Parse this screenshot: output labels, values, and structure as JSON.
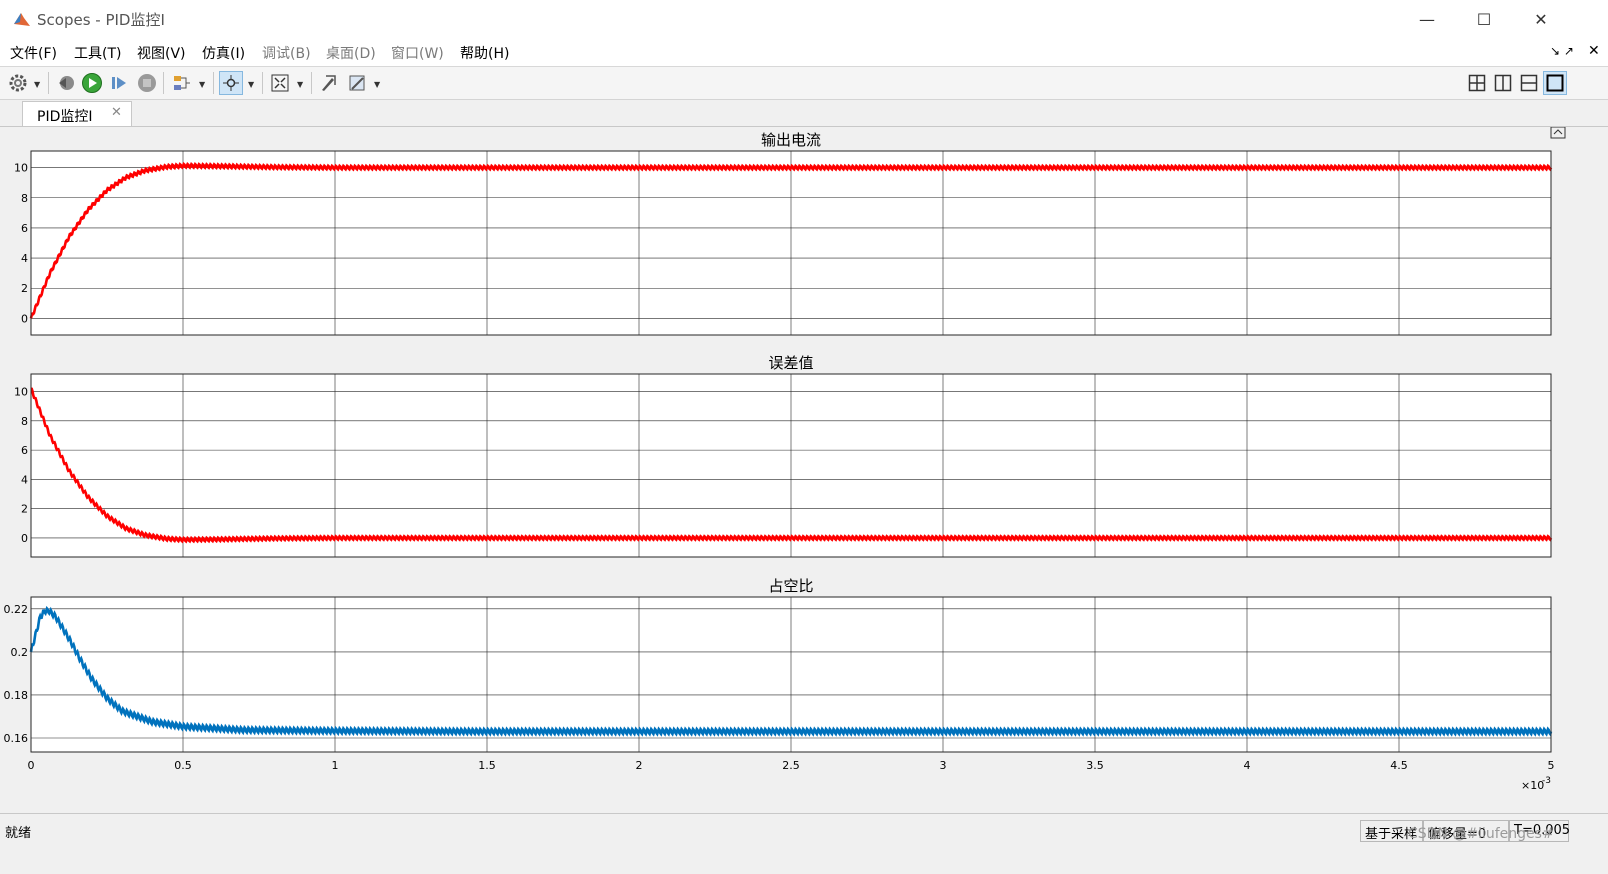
{
  "window": {
    "title": "Scopes - PID监控I",
    "minimize_glyph": "—",
    "maximize_glyph": "☐",
    "close_glyph": "✕"
  },
  "menu": {
    "items": [
      {
        "label": "文件(F)",
        "enabled": true
      },
      {
        "label": "工具(T)",
        "enabled": true
      },
      {
        "label": "视图(V)",
        "enabled": true
      },
      {
        "label": "仿真(I)",
        "enabled": true
      },
      {
        "label": "调试(B)",
        "enabled": false
      },
      {
        "label": "桌面(D)",
        "enabled": false
      },
      {
        "label": "窗口(W)",
        "enabled": false
      },
      {
        "label": "帮助(H)",
        "enabled": true
      }
    ],
    "undock_glyph": "↘ ↗",
    "close_glyph": "✕"
  },
  "toolbar": {
    "icons": [
      "gear-icon",
      "step-back-icon",
      "run-icon",
      "step-forward-icon",
      "stop-icon",
      "highlight-icon",
      "zoom-icon",
      "autoscale-icon",
      "style-icon",
      "measure-icon"
    ],
    "layout_icons": [
      "layout-2x2-icon",
      "layout-columns-icon",
      "layout-rows-icon",
      "layout-single-icon"
    ]
  },
  "tabs": [
    {
      "label": "PID监控I",
      "close_glyph": "✕"
    }
  ],
  "colors": {
    "red_trace": "#ff0000",
    "blue_trace": "#0072bd",
    "grid": "#262626"
  },
  "chart_data": [
    {
      "type": "line",
      "title": "输出电流",
      "x": [
        0,
        6.25e-05,
        0.000125,
        0.0001875,
        0.00025,
        0.0003125,
        0.000375,
        0.000445,
        0.0005,
        0.0006,
        0.0008,
        0.001,
        0.0015,
        0.002,
        0.003,
        0.004,
        0.005
      ],
      "series": [
        {
          "values": [
            0,
            3.0,
            5.4,
            7.2,
            8.5,
            9.35,
            9.8,
            10.05,
            10.12,
            10.1,
            10.03,
            10.0,
            10.0,
            10.0,
            10.0,
            10.0,
            10.0
          ],
          "color": "#ff0000"
        }
      ],
      "ylim": [
        -1.1,
        11.1
      ],
      "yticks": [
        "0",
        "2",
        "4",
        "6",
        "8",
        "10"
      ],
      "xlim": [
        0,
        0.005
      ],
      "grid": true,
      "ripple": 0.12
    },
    {
      "type": "line",
      "title": "误差值",
      "x": [
        0,
        6.25e-05,
        0.000125,
        0.0001875,
        0.00025,
        0.0003125,
        0.000375,
        0.000445,
        0.0005,
        0.0006,
        0.0008,
        0.001,
        0.0015,
        0.002,
        0.003,
        0.004,
        0.005
      ],
      "series": [
        {
          "values": [
            10.2,
            7.0,
            4.6,
            2.8,
            1.5,
            0.65,
            0.2,
            -0.05,
            -0.12,
            -0.1,
            -0.03,
            0.0,
            0.0,
            0.0,
            0.0,
            0.0,
            0.0
          ],
          "color": "#ff0000"
        }
      ],
      "ylim": [
        -1.3,
        11.2
      ],
      "yticks": [
        "0",
        "2",
        "4",
        "6",
        "8",
        "10"
      ],
      "xlim": [
        0,
        0.005
      ],
      "grid": true,
      "ripple": 0.12
    },
    {
      "type": "line",
      "title": "占空比",
      "x": [
        0,
        1.5e-05,
        3e-05,
        4.5e-05,
        6e-05,
        8e-05,
        0.0001,
        0.00013,
        0.00016,
        0.0002,
        0.00025,
        0.0003,
        0.0004,
        0.0005,
        0.0007,
        0.001,
        0.0015,
        0.002,
        0.003,
        0.004,
        0.005
      ],
      "series": [
        {
          "values": [
            0.2,
            0.208,
            0.216,
            0.219,
            0.219,
            0.2165,
            0.212,
            0.205,
            0.197,
            0.1875,
            0.1785,
            0.1725,
            0.1675,
            0.1653,
            0.1637,
            0.1633,
            0.163,
            0.163,
            0.163,
            0.163,
            0.163
          ],
          "color": "#0072bd"
        }
      ],
      "ylim": [
        0.1535,
        0.2255
      ],
      "yticks": [
        "0.16",
        "0.18",
        "0.2",
        "0.22"
      ],
      "xlim": [
        0,
        0.005
      ],
      "xticks": [
        "0",
        "0.5",
        "1",
        "1.5",
        "2",
        "2.5",
        "3",
        "3.5",
        "4",
        "4.5",
        "5"
      ],
      "xscale_label": "×10",
      "xscale_exponent": "-3",
      "grid": true,
      "ripple": 0.0012
    }
  ],
  "status": {
    "text": "就绪",
    "cells": [
      "基于采样",
      "偏移量=0",
      "T=0.005"
    ],
    "watermark": "CSDN @#liufenges#"
  }
}
